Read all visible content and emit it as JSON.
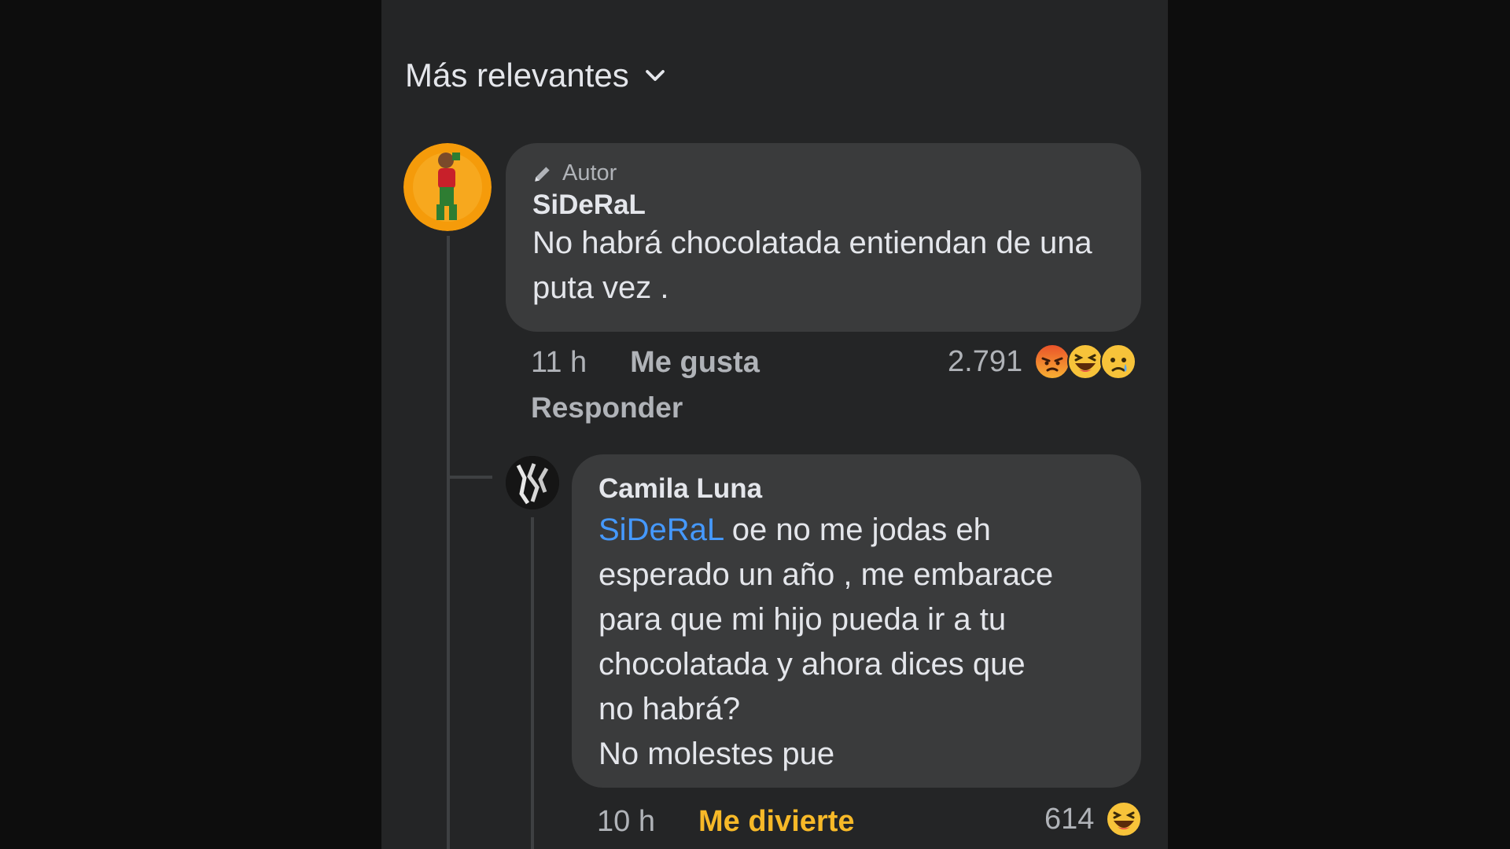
{
  "sort": {
    "label": "Más relevantes",
    "icon": "chevron-down-icon"
  },
  "comments": [
    {
      "badge": "Autor",
      "badge_icon": "pencil-icon",
      "author": "SiDeRaL",
      "text": "No habrá chocolatada entiendan de una puta vez .",
      "time": "11 h",
      "action": "Me gusta",
      "reply": "Responder",
      "reaction_count": "2.791",
      "reactions": [
        "angry-emoji-icon",
        "haha-emoji-icon",
        "sad-emoji-icon"
      ]
    },
    {
      "author": "Camila Luna",
      "mention": "SiDeRaL",
      "text_line1": " oe no me jodas eh",
      "text_line2": "esperado un año , me embarace",
      "text_line3": "para que mi hijo pueda ir a tu",
      "text_line4": "chocolatada y ahora dices que",
      "text_line5": "no habrá?",
      "text_line6": "No molestes pue",
      "time": "10 h",
      "action": "Me divierte",
      "reaction_count": "614",
      "reactions": [
        "haha-emoji-icon"
      ]
    }
  ],
  "colors": {
    "background": "#0d0d0d",
    "panel": "#242526",
    "bubble": "#3a3b3c",
    "mention": "#4599ff",
    "haha_action": "#f7b928"
  }
}
